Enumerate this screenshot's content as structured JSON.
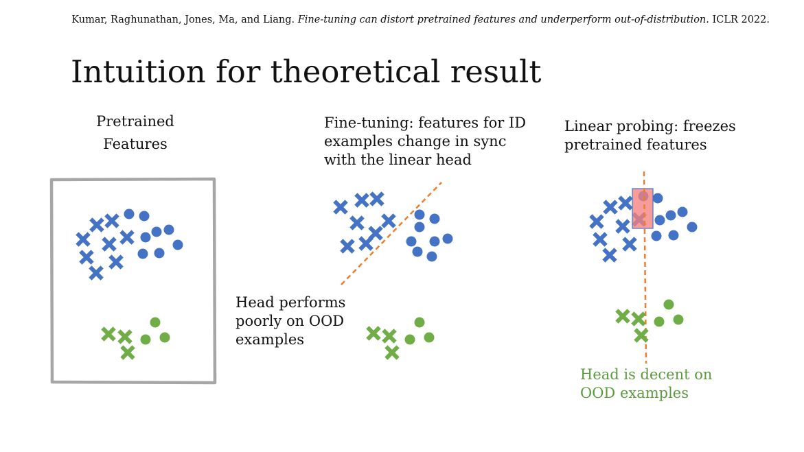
{
  "citation": {
    "authors": "Kumar, Raghunathan, Jones, Ma, and Liang.",
    "paper_title": "Fine-tuning can distort pretrained features and underperform out-of-distribution.",
    "venue": "ICLR 2022."
  },
  "title": "Intuition for theoretical result",
  "panels": {
    "pretrained": {
      "heading_line1": "Pretrained",
      "heading_line2": "Features"
    },
    "finetuning": {
      "heading_line1": "Fine-tuning: features for ID",
      "heading_line2": "examples change in sync",
      "heading_line3": "with the linear head",
      "note_line1": "Head performs",
      "note_line2": "poorly on OOD",
      "note_line3": "examples"
    },
    "linear_probing": {
      "heading_line1": "Linear probing: freezes",
      "heading_line2": "pretrained features",
      "note_line1": "Head is decent on",
      "note_line2": "OOD examples"
    }
  },
  "colors": {
    "id_points": "#4472c4",
    "ood_points": "#70ad47",
    "decision_line": "#ed7d31",
    "frame": "#a6a6a6",
    "highlight": "#f4817f",
    "note_text": "#5b9a3e"
  }
}
